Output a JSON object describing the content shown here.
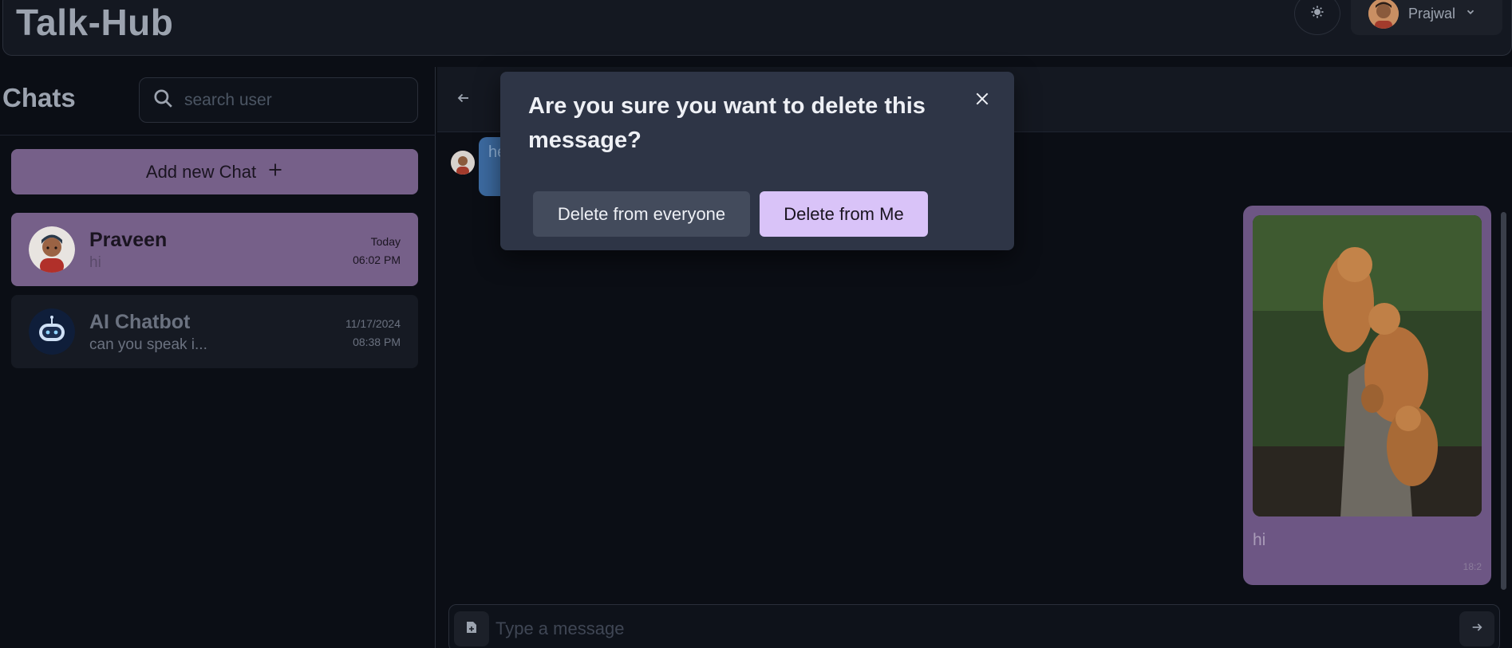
{
  "header": {
    "app_title": "Talk-Hub",
    "user_name": "Prajwal"
  },
  "sidebar": {
    "title": "Chats",
    "search_placeholder": "search user",
    "add_chat_label": "Add new Chat",
    "chats": [
      {
        "name": "Praveen",
        "preview": "hi",
        "date": "Today",
        "time": "06:02 PM",
        "active": true
      },
      {
        "name": "AI Chatbot",
        "preview": "can you speak i...",
        "date": "11/17/2024",
        "time": "08:38 PM",
        "active": false
      }
    ]
  },
  "conversation": {
    "incoming_text": "he",
    "outgoing_text": "hi",
    "outgoing_time": "18:2",
    "composer_placeholder": "Type a message"
  },
  "modal": {
    "title": "Are you sure you want to delete this message?",
    "delete_everyone_label": "Delete from everyone",
    "delete_me_label": "Delete from Me"
  },
  "colors": {
    "accent": "#d9c3f8",
    "active_chat": "#766089",
    "background": "#0b0e15"
  }
}
